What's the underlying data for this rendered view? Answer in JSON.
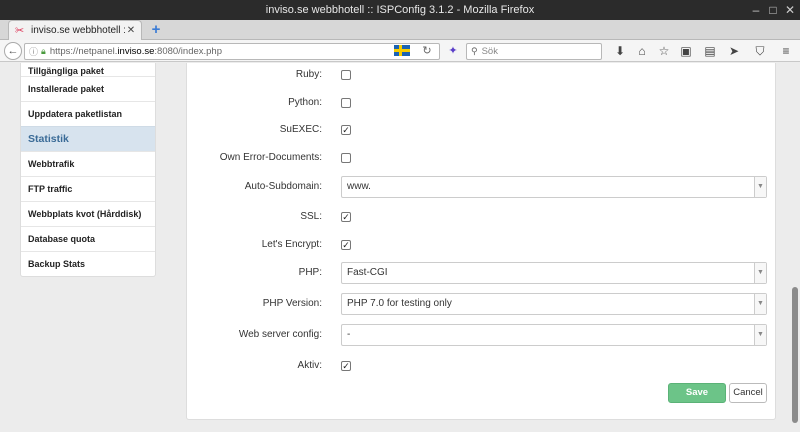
{
  "window": {
    "title": "inviso.se webbhotell :: ISPConfig 3.1.2 - Mozilla Firefox"
  },
  "tabs": [
    {
      "title": "inviso.se webbhotell :: ISPC..."
    }
  ],
  "urlbar": {
    "prefix": "https://netpanel.",
    "host": "inviso.se",
    "suffix": ":8080/index.php"
  },
  "search": {
    "placeholder": "Sök"
  },
  "sidebar": {
    "items": [
      {
        "label": "Tillgängliga paket",
        "state": "partial"
      },
      {
        "label": "Installerade paket"
      },
      {
        "label": "Uppdatera paketlistan"
      },
      {
        "label": "Statistik",
        "state": "active"
      },
      {
        "label": "Webbtrafik"
      },
      {
        "label": "FTP traffic"
      },
      {
        "label": "Webbplats kvot (Hårddisk)"
      },
      {
        "label": "Database quota"
      },
      {
        "label": "Backup Stats"
      }
    ]
  },
  "form": {
    "ruby": {
      "label": "Ruby:",
      "checked": false
    },
    "python": {
      "label": "Python:",
      "checked": false
    },
    "suexec": {
      "label": "SuEXEC:",
      "checked": true
    },
    "own_error_docs": {
      "label": "Own Error-Documents:",
      "checked": false
    },
    "auto_subdomain": {
      "label": "Auto-Subdomain:",
      "value": "www."
    },
    "ssl": {
      "label": "SSL:",
      "checked": true
    },
    "letsencrypt": {
      "label": "Let's Encrypt:",
      "checked": true
    },
    "php": {
      "label": "PHP:",
      "value": "Fast-CGI"
    },
    "php_version": {
      "label": "PHP Version:",
      "value": "PHP 7.0 for testing only"
    },
    "web_server_config": {
      "label": "Web server config:",
      "value": "-"
    },
    "active": {
      "label": "Aktiv:",
      "checked": true
    },
    "save_label": "Save",
    "cancel_label": "Cancel"
  },
  "colors": {
    "accent_active": "#d7e3ee",
    "save_button": "#6cc488",
    "titlebar": "#2b2b2b"
  }
}
